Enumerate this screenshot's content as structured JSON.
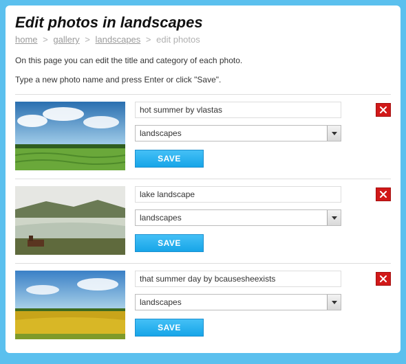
{
  "header": {
    "title": "Edit photos in landscapes"
  },
  "breadcrumb": {
    "items": [
      {
        "label": "home",
        "link": true
      },
      {
        "label": "gallery",
        "link": true
      },
      {
        "label": "landscapes",
        "link": true
      },
      {
        "label": "edit photos",
        "link": false
      }
    ],
    "separator": ">"
  },
  "intro": {
    "line1": "On this page you can edit the title and category of each photo.",
    "line2": "Type a new photo name and press Enter or click \"Save\"."
  },
  "buttons": {
    "save": "SAVE"
  },
  "photos": [
    {
      "title": "hot summer by vlastas",
      "category": "landscapes"
    },
    {
      "title": "lake landscape",
      "category": "landscapes"
    },
    {
      "title": "that summer day by bcausesheexists",
      "category": "landscapes"
    }
  ]
}
